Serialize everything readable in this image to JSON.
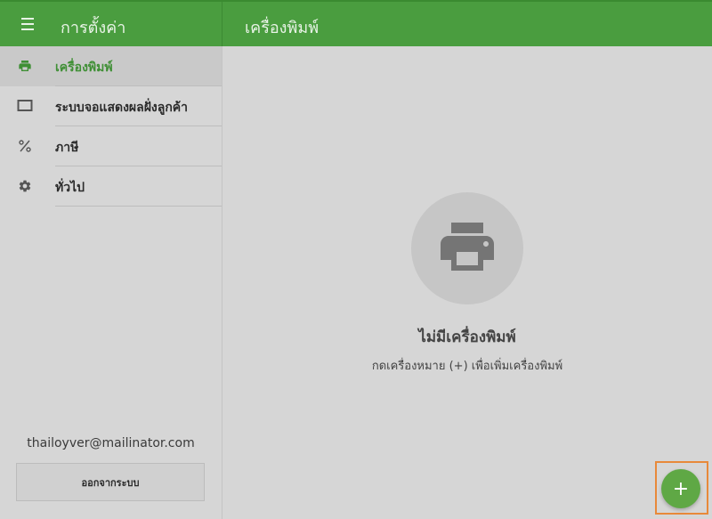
{
  "header": {
    "app_title": "การตั้งค่า",
    "page_title": "เครื่องพิมพ์",
    "menu_icon": "hamburger-menu-icon"
  },
  "sidebar": {
    "items": [
      {
        "label": "เครื่องพิมพ์",
        "icon": "printer-icon",
        "active": true
      },
      {
        "label": "ระบบจอแสดงผลฝั่งลูกค้า",
        "icon": "display-icon",
        "active": false
      },
      {
        "label": "ภาษี",
        "icon": "percent-icon",
        "active": false
      },
      {
        "label": "ทั่วไป",
        "icon": "gear-icon",
        "active": false
      }
    ],
    "email": "thailoyver@mailinator.com",
    "logout_label": "ออกจากระบบ"
  },
  "main": {
    "empty_icon": "printer-icon",
    "empty_title": "ไม่มีเครื่องพิมพ์",
    "empty_subtitle": "กดเครื่องหมาย (+) เพื่อเพิ่มเครื่องพิมพ์",
    "fab_label": "+"
  },
  "colors": {
    "header_bg": "#4a9d3f",
    "accent": "#3f8f35",
    "fab": "#5fa845",
    "highlight": "#e8893a"
  }
}
